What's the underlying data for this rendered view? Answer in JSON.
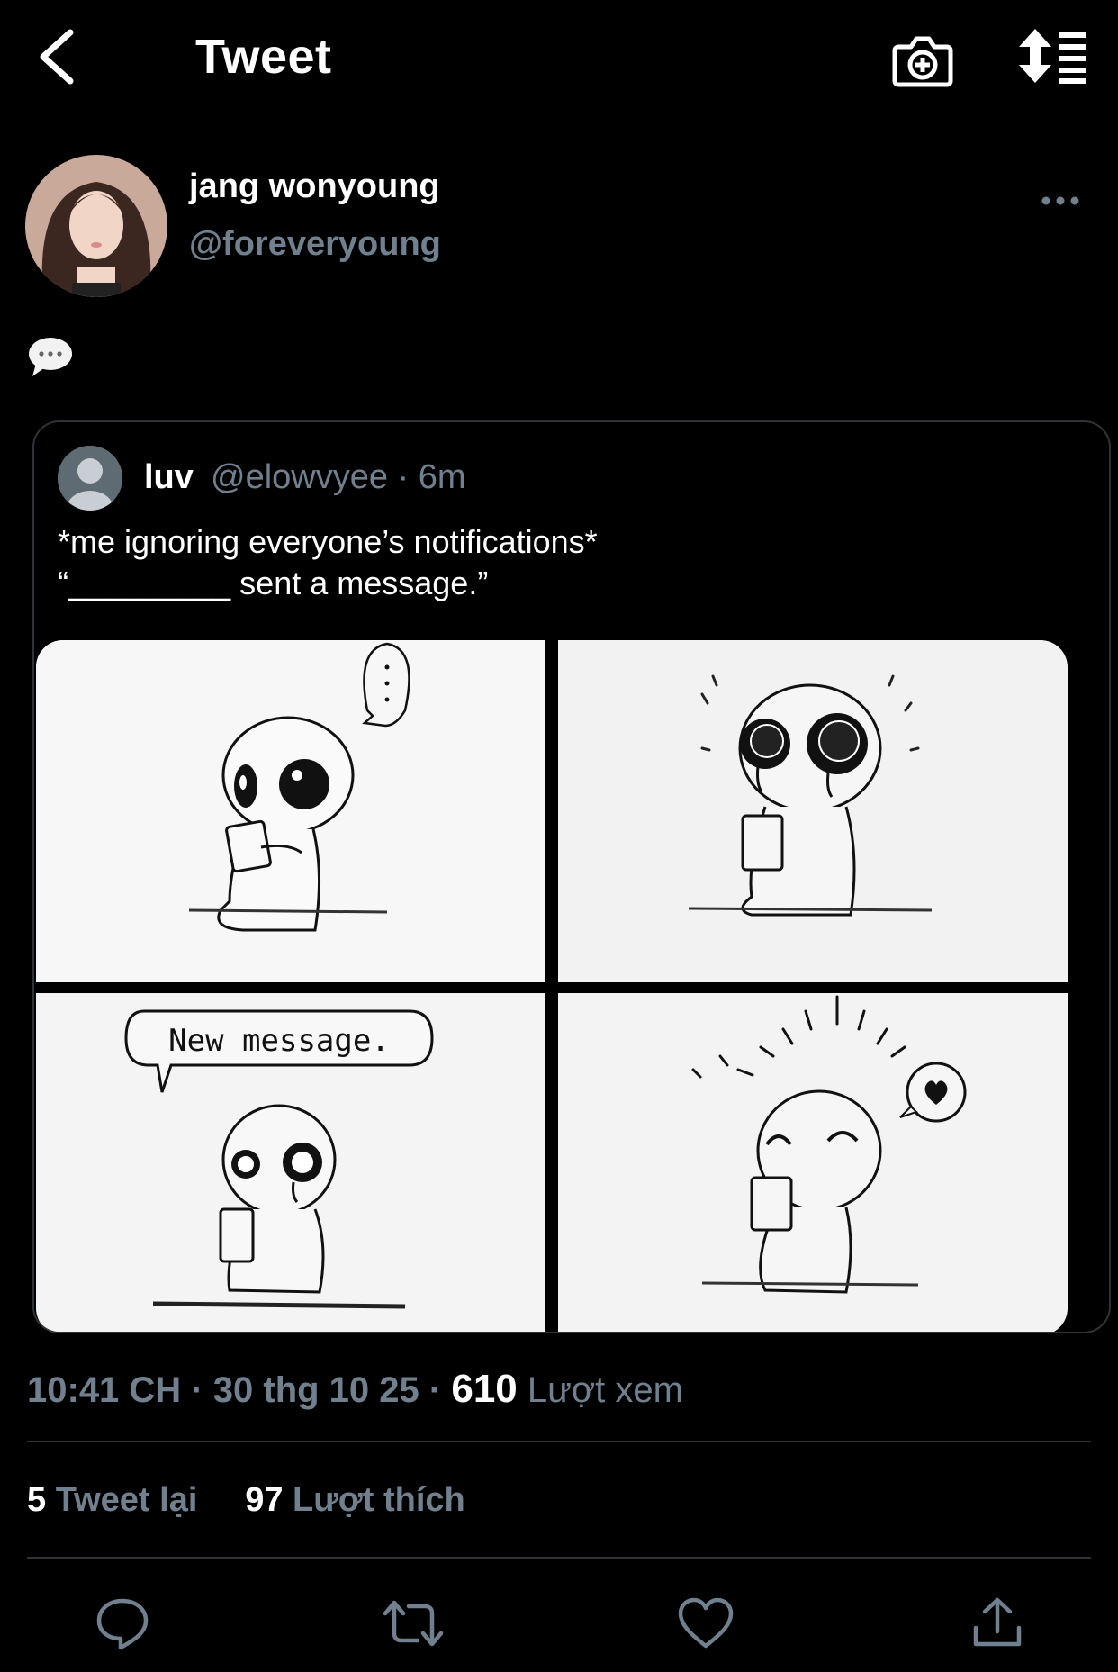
{
  "header": {
    "title": "Tweet",
    "back_icon": "chevron-left-icon",
    "camera_icon": "camera-add-icon",
    "sort_icon": "sort-list-icon"
  },
  "tweet": {
    "display_name": "jang wonyoung",
    "handle": "@foreveryoung",
    "text_emoji": "speech-balloon-icon",
    "time": "10:41 CH",
    "date": "30 thg 10 25",
    "views_count": "610",
    "views_label": "Lượt xem",
    "retweets_count": "5",
    "retweets_label": "Tweet lại",
    "likes_count": "97",
    "likes_label": "Lượt thích"
  },
  "quote": {
    "name": "luv",
    "handle_time": "@elowvyee · 6m",
    "text": "*me ignoring everyone’s notifications*\n“_________ sent a message.”",
    "panel_3_bubble": "New message."
  },
  "actions": [
    "reply-icon",
    "retweet-icon",
    "like-icon",
    "share-icon"
  ],
  "colors": {
    "background": "#000000",
    "secondary_text": "#71808e",
    "divider": "#2f3336"
  }
}
